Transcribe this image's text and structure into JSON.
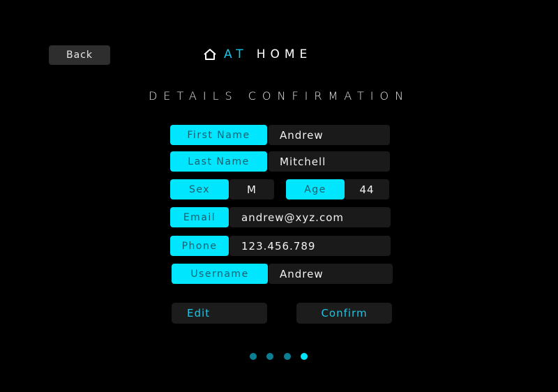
{
  "nav": {
    "back_label": "Back"
  },
  "brand": {
    "accent": "AT",
    "rest": "HOME"
  },
  "page": {
    "heading": "DETAILS CONFIRMATION"
  },
  "form": {
    "first_name": {
      "label": "First Name",
      "value": "Andrew"
    },
    "last_name": {
      "label": "Last Name",
      "value": "Mitchell"
    },
    "sex": {
      "label": "Sex",
      "value": "M"
    },
    "age": {
      "label": "Age",
      "value": "44"
    },
    "email": {
      "label": "Email",
      "value": "andrew@xyz.com"
    },
    "phone": {
      "label": "Phone",
      "value": "123.456.789"
    },
    "username": {
      "label": "Username",
      "value": "Andrew"
    }
  },
  "actions": {
    "edit_label": "Edit",
    "confirm_label": "Confirm"
  },
  "pagination": {
    "total": 4,
    "current": 4
  },
  "colors": {
    "accent": "#00e6ff",
    "background": "#000000",
    "field": "#1a1a1a",
    "dot_inactive": "#0a7f93"
  },
  "icons": {
    "brand": "house-icon"
  }
}
